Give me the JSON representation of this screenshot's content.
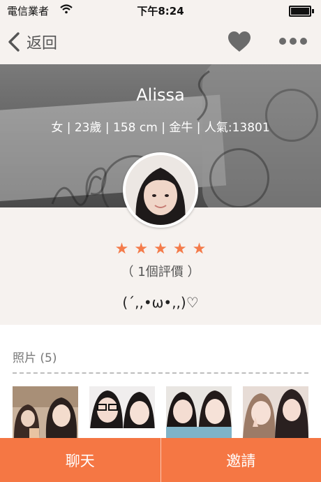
{
  "status_bar": {
    "carrier": "電信業者",
    "time": "下午8:24"
  },
  "nav": {
    "back_label": "返回"
  },
  "profile": {
    "name": "Alissa",
    "info": "女 | 23歲 | 158 cm | 金牛 | 人氣:13801",
    "rating": 5,
    "reviews": "（ 1個評價 ）",
    "bio": "(´,,•ω•,,)♡"
  },
  "photos": {
    "title": "照片 (5)"
  },
  "actions": {
    "chat_label": "聊天",
    "invite_label": "邀請"
  },
  "colors": {
    "accent": "#f57744",
    "star": "#f47b4a",
    "background": "#f6f2ef"
  }
}
